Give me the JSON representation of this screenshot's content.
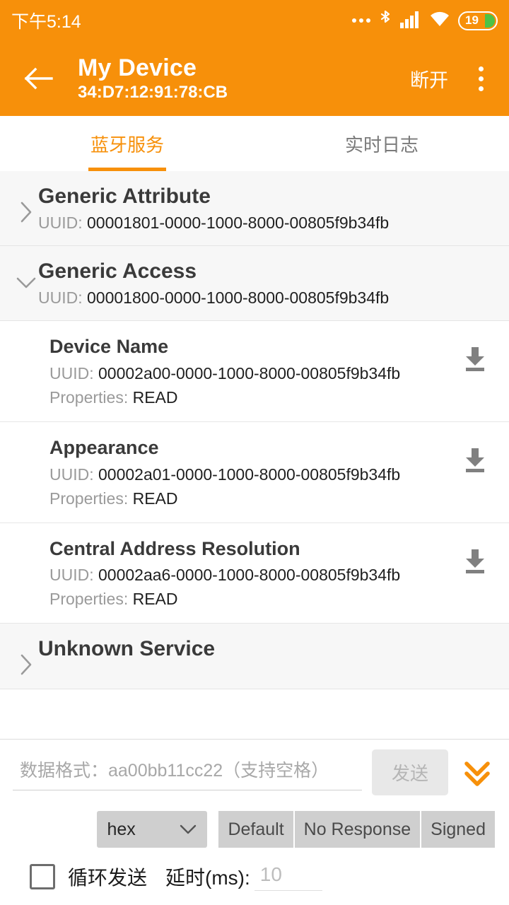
{
  "statusbar": {
    "time": "下午5:14",
    "icons": [
      "more-dots-icon",
      "bluetooth-icon",
      "cellular-signal-icon",
      "wifi-icon"
    ],
    "battery_level": "19"
  },
  "appbar": {
    "back_icon": "back-arrow-icon",
    "title": "My Device",
    "subtitle": "34:D7:12:91:78:CB",
    "disconnect_label": "断开",
    "overflow_icon": "overflow-menu-icon"
  },
  "tabs": [
    {
      "label": "蓝牙服务",
      "active": true
    },
    {
      "label": "实时日志",
      "active": false
    }
  ],
  "labels": {
    "uuid_prefix": "UUID:",
    "properties_prefix": "Properties:"
  },
  "services": [
    {
      "name": "Generic Attribute",
      "uuid": "00001801-0000-1000-8000-00805f9b34fb",
      "expanded": false,
      "chevron": "chevron-right-icon",
      "characteristics": []
    },
    {
      "name": "Generic Access",
      "uuid": "00001800-0000-1000-8000-00805f9b34fb",
      "expanded": true,
      "chevron": "chevron-down-icon",
      "characteristics": [
        {
          "name": "Device Name",
          "uuid": "00002a00-0000-1000-8000-00805f9b34fb",
          "properties": "READ",
          "action_icon": "download-icon"
        },
        {
          "name": "Appearance",
          "uuid": "00002a01-0000-1000-8000-00805f9b34fb",
          "properties": "READ",
          "action_icon": "download-icon"
        },
        {
          "name": "Central Address Resolution",
          "uuid": "00002aa6-0000-1000-8000-00805f9b34fb",
          "properties": "READ",
          "action_icon": "download-icon"
        }
      ]
    },
    {
      "name": "Unknown Service",
      "uuid": "",
      "expanded": false,
      "chevron": "chevron-right-icon",
      "characteristics": []
    }
  ],
  "bottom_panel": {
    "data_input_placeholder": "数据格式：aa00bb11cc22（支持空格）",
    "data_input_value": "",
    "send_label": "发送",
    "send_disabled": true,
    "expand_icon": "double-chevron-down-icon",
    "format_select": {
      "value": "hex",
      "caret_icon": "chevron-down-icon"
    },
    "write_modes": [
      "Default",
      "No Response",
      "Signed"
    ],
    "loop_checkbox": {
      "checked": false,
      "label": "循环发送"
    },
    "delay_label": "延时(ms):",
    "delay_placeholder": "10",
    "delay_value": ""
  },
  "colors": {
    "accent": "#F7900A",
    "battery_fill": "#4DC247",
    "service_bg": "#f7f7f7"
  }
}
